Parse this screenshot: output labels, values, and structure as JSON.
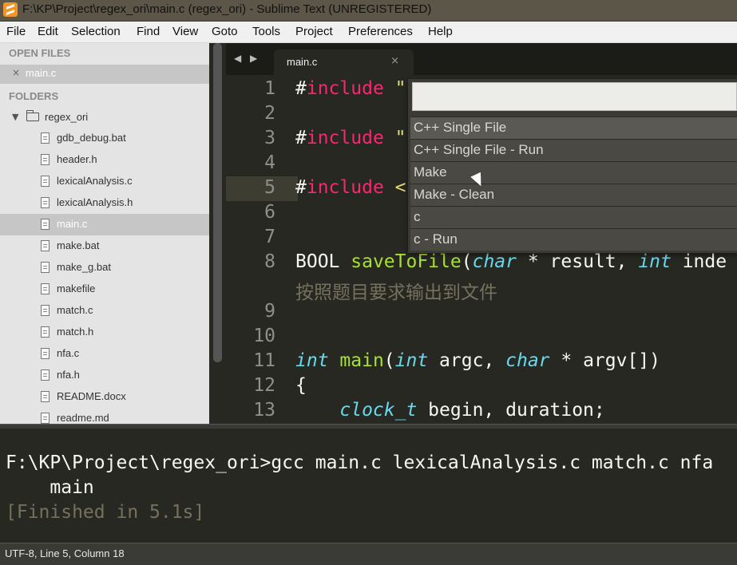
{
  "window": {
    "title": "F:\\KP\\Project\\regex_ori\\main.c (regex_ori) - Sublime Text (UNREGISTERED)"
  },
  "menu": [
    "File",
    "Edit",
    "Selection",
    "Find",
    "View",
    "Goto",
    "Tools",
    "Project",
    "Preferences",
    "Help"
  ],
  "sidebar": {
    "open_files_header": "OPEN FILES",
    "open_files": [
      {
        "name": "main.c",
        "close_glyph": "×"
      }
    ],
    "folders_header": "FOLDERS",
    "folder": {
      "name": "regex_ori",
      "expanded_glyph": "▼"
    },
    "files": [
      {
        "name": "gdb_debug.bat"
      },
      {
        "name": "header.h"
      },
      {
        "name": "lexicalAnalysis.c"
      },
      {
        "name": "lexicalAnalysis.h"
      },
      {
        "name": "main.c",
        "selected": true
      },
      {
        "name": "make.bat"
      },
      {
        "name": "make_g.bat"
      },
      {
        "name": "makefile"
      },
      {
        "name": "match.c"
      },
      {
        "name": "match.h"
      },
      {
        "name": "nfa.c"
      },
      {
        "name": "nfa.h"
      },
      {
        "name": "README.docx"
      },
      {
        "name": "readme.md"
      }
    ]
  },
  "tabs": {
    "nav_left": "◀",
    "nav_right": "▶",
    "active": {
      "label": "main.c",
      "close_glyph": "×"
    }
  },
  "editor": {
    "current_line": 5,
    "lines": [
      {
        "n": "1",
        "parts": [
          {
            "t": "#"
          },
          {
            "t": "include",
            "c": "kw-red"
          },
          {
            "t": " \"",
            "c": "str"
          }
        ]
      },
      {
        "n": "2",
        "parts": []
      },
      {
        "n": "3",
        "parts": [
          {
            "t": "#"
          },
          {
            "t": "include",
            "c": "kw-red"
          },
          {
            "t": " \"",
            "c": "str"
          }
        ]
      },
      {
        "n": "4",
        "parts": []
      },
      {
        "n": "5",
        "parts": [
          {
            "t": "#"
          },
          {
            "t": "include",
            "c": "kw-red"
          },
          {
            "t": " <",
            "c": "str"
          }
        ]
      },
      {
        "n": "6",
        "parts": []
      },
      {
        "n": "7",
        "parts": []
      },
      {
        "n": "8",
        "parts": [
          {
            "t": "BOOL "
          },
          {
            "t": "saveToFile",
            "c": "fn-green"
          },
          {
            "t": "("
          },
          {
            "t": "char",
            "c": "kw-type"
          },
          {
            "t": " * result, "
          },
          {
            "t": "int",
            "c": "kw-type"
          },
          {
            "t": " inde"
          }
        ]
      },
      {
        "n": "",
        "parts": [
          {
            "t": "按照题目要求输出到文件",
            "c": "cmt"
          }
        ]
      },
      {
        "n": "9",
        "parts": []
      },
      {
        "n": "10",
        "parts": []
      },
      {
        "n": "11",
        "parts": [
          {
            "t": "int",
            "c": "kw-type"
          },
          {
            "t": " "
          },
          {
            "t": "main",
            "c": "fn-green"
          },
          {
            "t": "("
          },
          {
            "t": "int",
            "c": "kw-type"
          },
          {
            "t": " argc, "
          },
          {
            "t": "char",
            "c": "kw-type"
          },
          {
            "t": " * argv[])"
          }
        ]
      },
      {
        "n": "12",
        "parts": [
          {
            "t": "{"
          }
        ]
      },
      {
        "n": "13",
        "parts": [
          {
            "t": "    "
          },
          {
            "t": "clock_t",
            "c": "kw-type"
          },
          {
            "t": " begin, duration;"
          }
        ]
      }
    ]
  },
  "command_palette": {
    "query": "",
    "items": [
      {
        "label": "C++ Single File",
        "active": true
      },
      {
        "label": "C++ Single File - Run"
      },
      {
        "label": "Make"
      },
      {
        "label": "Make - Clean"
      },
      {
        "label": "c"
      },
      {
        "label": "c - Run"
      }
    ]
  },
  "output": {
    "lines": [
      "F:\\KP\\Project\\regex_ori>gcc main.c lexicalAnalysis.c match.c nfa",
      "    main"
    ],
    "finished": "[Finished in 5.1s]"
  },
  "status": {
    "text": "UTF-8, Line 5, Column 18"
  }
}
